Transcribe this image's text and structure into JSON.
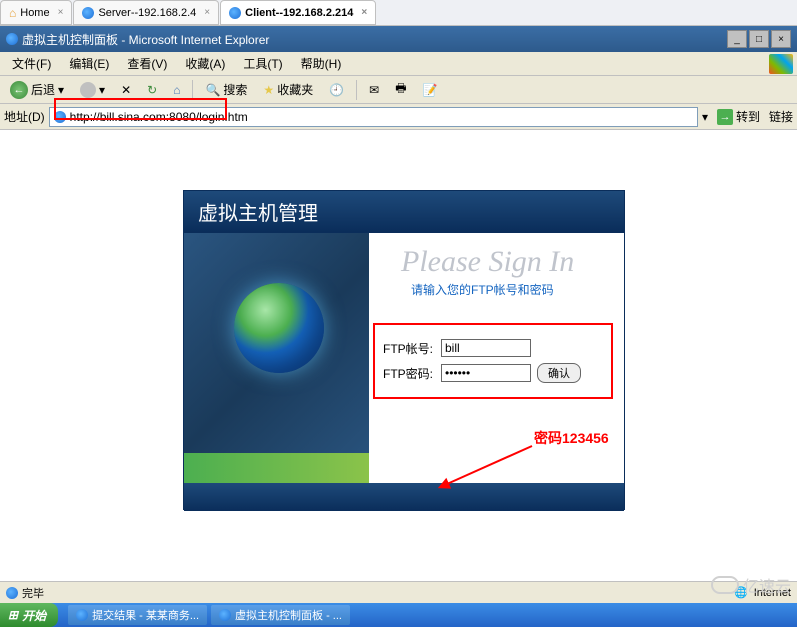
{
  "tabs": [
    {
      "label": "Home",
      "icon": "home"
    },
    {
      "label": "Server--192.168.2.4",
      "icon": "ie"
    },
    {
      "label": "Client--192.168.2.214",
      "icon": "ie",
      "active": true
    }
  ],
  "title": "虚拟主机控制面板 - Microsoft Internet Explorer",
  "menu": {
    "file": "文件(F)",
    "edit": "编辑(E)",
    "view": "查看(V)",
    "favorites": "收藏(A)",
    "tools": "工具(T)",
    "help": "帮助(H)"
  },
  "toolbar": {
    "back": "后退",
    "search": "搜索",
    "favorites": "收藏夹"
  },
  "address": {
    "label": "地址(D)",
    "url": "http://bill.sina.com:8080/login.htm",
    "go": "转到",
    "links": "链接"
  },
  "panel": {
    "title": "虚拟主机管理",
    "signin": "Please Sign In",
    "subtitle": "请输入您的FTP帐号和密码",
    "ftp_user_label": "FTP帐号:",
    "ftp_user_value": "bill",
    "ftp_pass_label": "FTP密码:",
    "ftp_pass_value": "123456",
    "submit": "确认"
  },
  "annotation": "密码123456",
  "status": {
    "done": "完毕",
    "zone": "Internet"
  },
  "taskbar": {
    "start": "开始",
    "items": [
      "提交结果 - 某某商务...",
      "虚拟主机控制面板 - ..."
    ]
  },
  "watermark": "亿速云"
}
